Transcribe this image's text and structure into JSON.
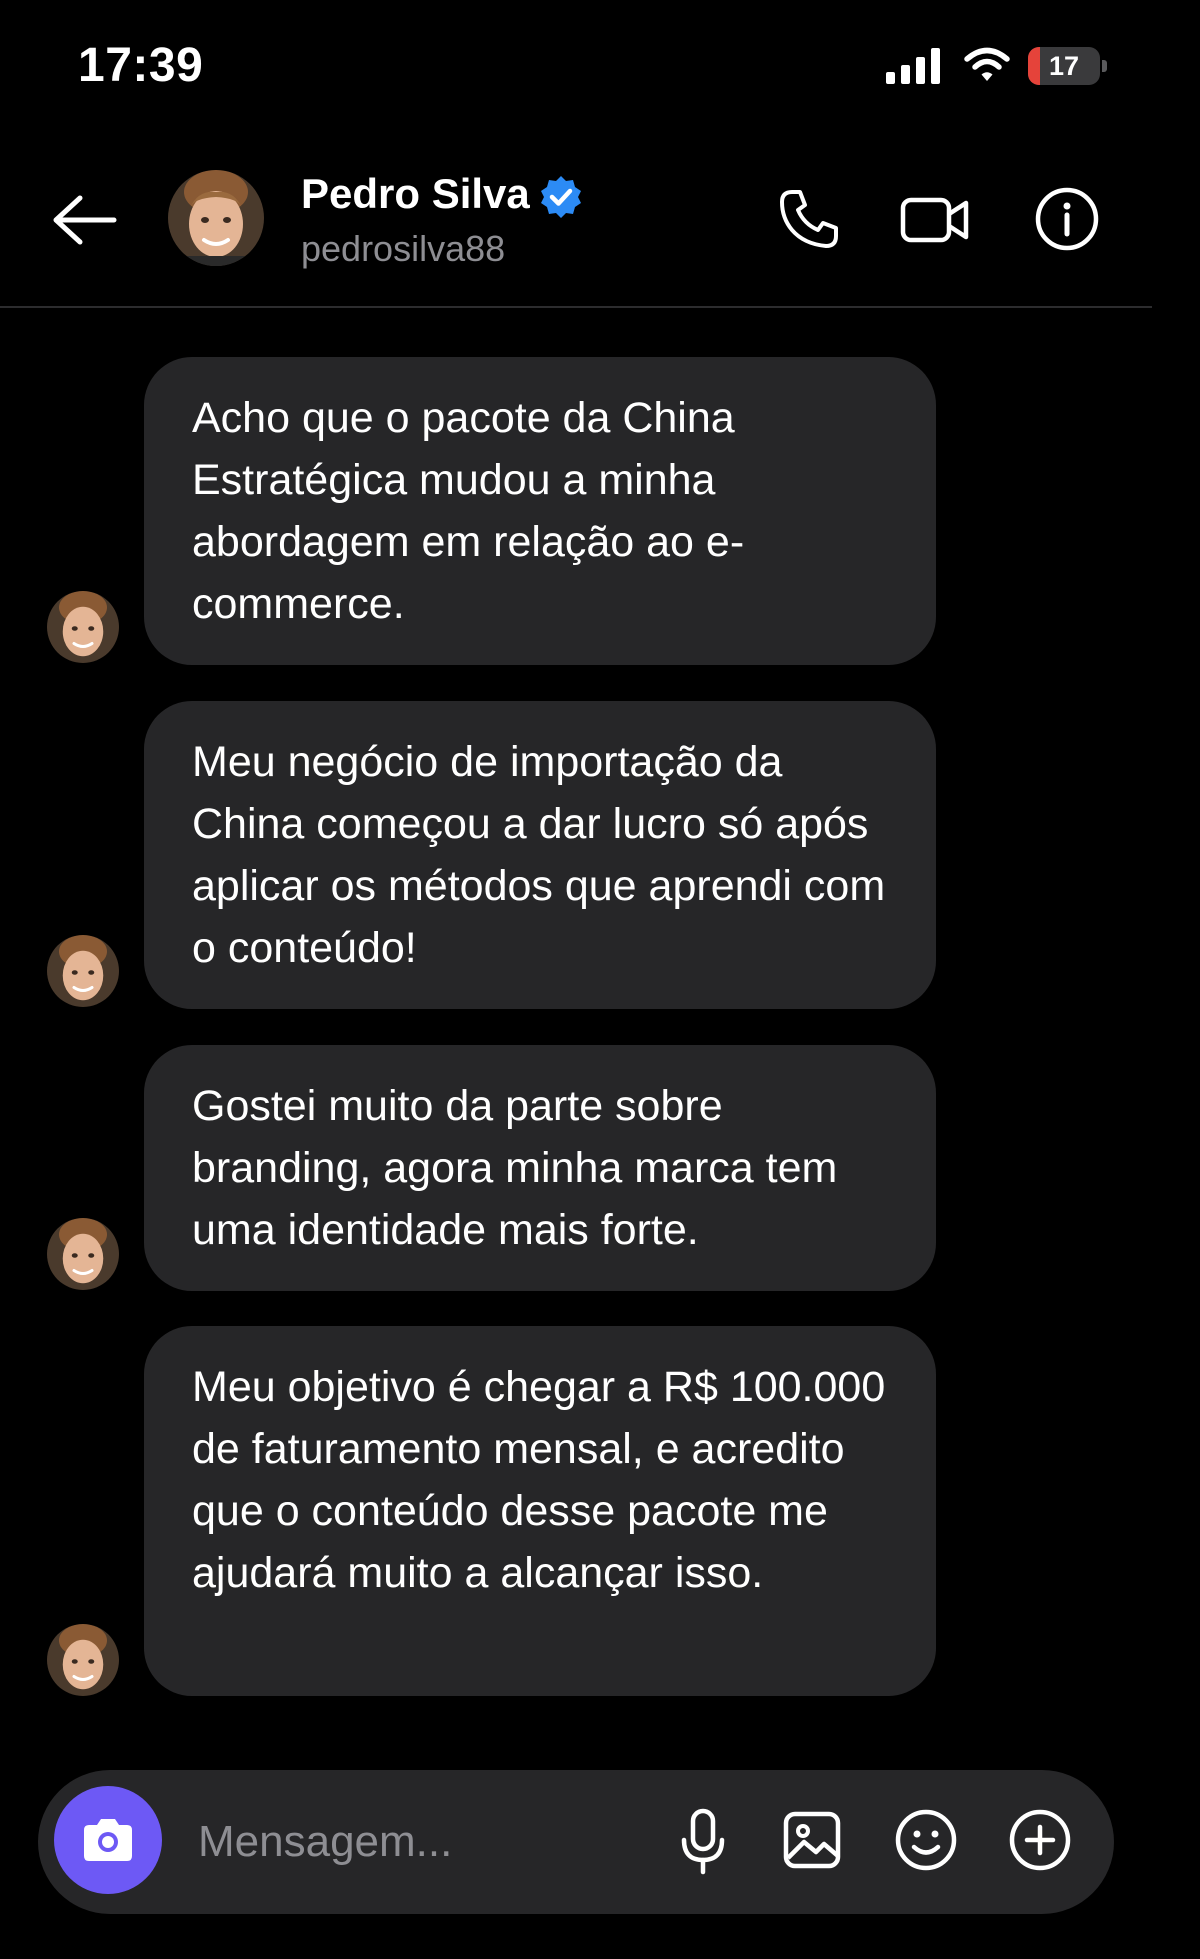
{
  "status_bar": {
    "time": "17:39",
    "battery_level": "17",
    "battery_color": "#e5433a"
  },
  "header": {
    "contact_name": "Pedro Silva",
    "contact_handle": "pedrosilva88",
    "verified_color": "#2c8bf5",
    "icons": [
      "back-arrow",
      "avatar",
      "verified-badge",
      "phone",
      "video-camera",
      "info"
    ]
  },
  "messages": [
    {
      "text": "Acho que o pacote da China Estratégica mudou a minha abordagem em relação ao e-commerce."
    },
    {
      "text": "Meu negócio de importação da China começou a dar lucro só após aplicar os métodos que aprendi com o conteúdo!"
    },
    {
      "text": "Gostei muito da parte sobre branding, agora minha marca tem uma identidade mais forte."
    },
    {
      "text": "Meu objetivo é chegar a R$ 100.000 de faturamento mensal, e acredito que o conteúdo desse pacote me ajudará muito a alcançar isso."
    }
  ],
  "composer": {
    "placeholder": "Mensagem...",
    "accent_color": "#6d59f5",
    "icons": [
      "camera",
      "microphone",
      "gallery",
      "emoji",
      "plus"
    ]
  },
  "theme": {
    "background": "#000000",
    "bubble": "#262628",
    "secondary_text": "#8e8e93"
  }
}
